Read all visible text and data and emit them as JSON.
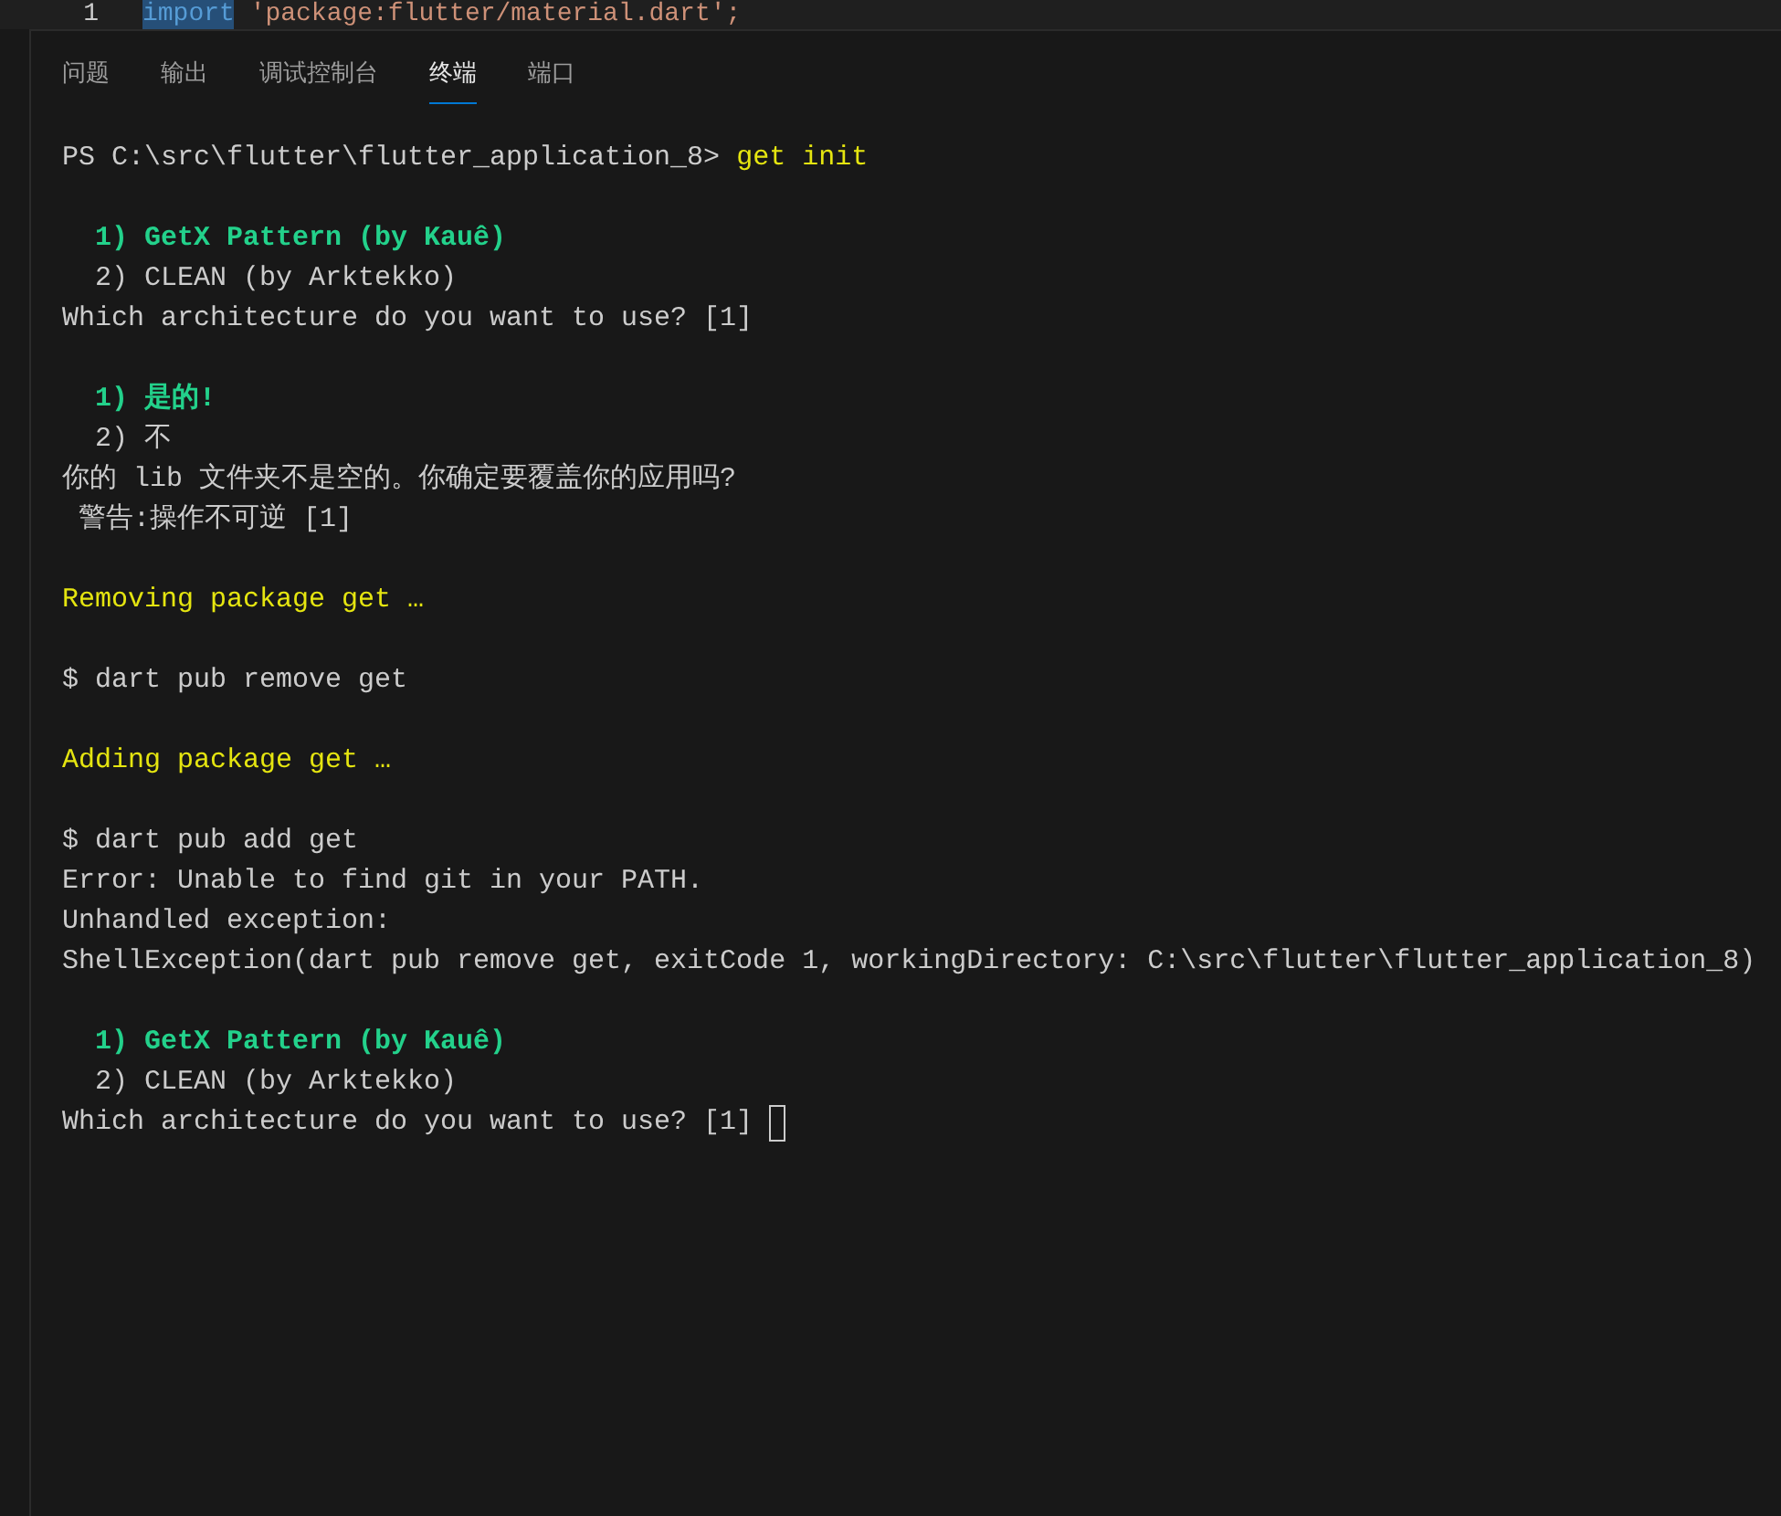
{
  "editor": {
    "line_number": "1",
    "keyword": "import",
    "code": " 'package:flutter/material.dart';"
  },
  "tabs": [
    {
      "label": "问题",
      "selected": false
    },
    {
      "label": "输出",
      "selected": false
    },
    {
      "label": "调试控制台",
      "selected": false
    },
    {
      "label": "终端",
      "selected": true
    },
    {
      "label": "端口",
      "selected": false
    }
  ],
  "terminal": {
    "lines": [
      {
        "kind": "prompt",
        "text": "PS C:\\src\\flutter\\flutter_application_8> ",
        "command": "get init"
      },
      {
        "kind": "blank"
      },
      {
        "kind": "option_selected",
        "text": "  1) GetX Pattern (by Kauê)"
      },
      {
        "kind": "option",
        "text": "  2) CLEAN (by Arktekko)"
      },
      {
        "kind": "plain",
        "text": "Which architecture do you want to use? [1]"
      },
      {
        "kind": "blank"
      },
      {
        "kind": "option_selected",
        "text": "  1) 是的!"
      },
      {
        "kind": "option",
        "text": "  2) 不"
      },
      {
        "kind": "plain",
        "text": "你的 lib 文件夹不是空的。你确定要覆盖你的应用吗?"
      },
      {
        "kind": "plain",
        "text": " 警告:操作不可逆 [1]"
      },
      {
        "kind": "blank"
      },
      {
        "kind": "info",
        "text": "Removing package get …"
      },
      {
        "kind": "blank"
      },
      {
        "kind": "plain",
        "text": "$ dart pub remove get"
      },
      {
        "kind": "blank"
      },
      {
        "kind": "info",
        "text": "Adding package get …"
      },
      {
        "kind": "blank"
      },
      {
        "kind": "plain",
        "text": "$ dart pub add get"
      },
      {
        "kind": "plain",
        "text": "Error: Unable to find git in your PATH."
      },
      {
        "kind": "plain",
        "text": "Unhandled exception:"
      },
      {
        "kind": "plain",
        "text": "ShellException(dart pub remove get, exitCode 1, workingDirectory: C:\\src\\flutter\\flutter_application_8)"
      },
      {
        "kind": "blank"
      },
      {
        "kind": "option_selected",
        "text": "  1) GetX Pattern (by Kauê)"
      },
      {
        "kind": "option",
        "text": "  2) CLEAN (by Arktekko)"
      },
      {
        "kind": "input",
        "text": "Which architecture do you want to use? [1] "
      }
    ]
  }
}
